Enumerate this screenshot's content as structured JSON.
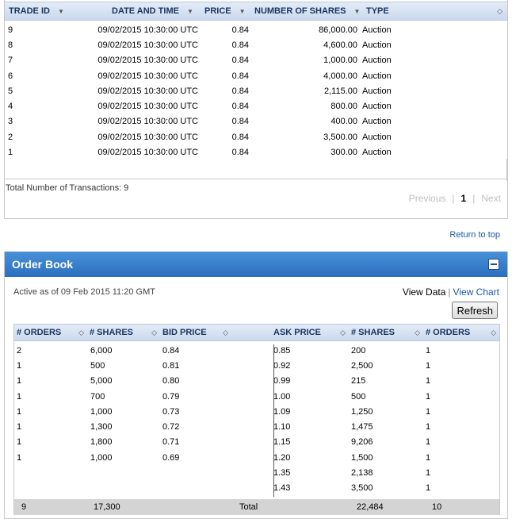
{
  "trades": {
    "headers": {
      "trade_id": "TRADE ID",
      "date_time": "DATE AND TIME",
      "price": "PRICE",
      "num_shares": "NUMBER OF SHARES",
      "type": "TYPE"
    },
    "rows": [
      {
        "id": "9",
        "date": "09/02/2015 10:30:00 UTC",
        "price": "0.84",
        "shares": "86,000.00",
        "type": "Auction"
      },
      {
        "id": "8",
        "date": "09/02/2015 10:30:00 UTC",
        "price": "0.84",
        "shares": "4,600.00",
        "type": "Auction"
      },
      {
        "id": "7",
        "date": "09/02/2015 10:30:00 UTC",
        "price": "0.84",
        "shares": "1,000.00",
        "type": "Auction"
      },
      {
        "id": "6",
        "date": "09/02/2015 10:30:00 UTC",
        "price": "0.84",
        "shares": "4,000.00",
        "type": "Auction"
      },
      {
        "id": "5",
        "date": "09/02/2015 10:30:00 UTC",
        "price": "0.84",
        "shares": "2,115.00",
        "type": "Auction"
      },
      {
        "id": "4",
        "date": "09/02/2015 10:30:00 UTC",
        "price": "0.84",
        "shares": "800.00",
        "type": "Auction"
      },
      {
        "id": "3",
        "date": "09/02/2015 10:30:00 UTC",
        "price": "0.84",
        "shares": "400.00",
        "type": "Auction"
      },
      {
        "id": "2",
        "date": "09/02/2015 10:30:00 UTC",
        "price": "0.84",
        "shares": "3,500.00",
        "type": "Auction"
      },
      {
        "id": "1",
        "date": "09/02/2015 10:30:00 UTC",
        "price": "0.84",
        "shares": "300.00",
        "type": "Auction"
      }
    ],
    "total_label": "Total Number of Transactions: 9",
    "pager": {
      "previous": "Previous",
      "current": "1",
      "next": "Next"
    }
  },
  "return_to_top": "Return to top",
  "order_book": {
    "title": "Order Book",
    "active_as": "Active as of 09 Feb 2015 11:20 GMT",
    "view_data": "View Data",
    "view_chart": "View Chart",
    "refresh": "Refresh",
    "headers": {
      "bid_orders": "# ORDERS",
      "bid_shares": "# SHARES",
      "bid_price": "BID PRICE",
      "ask_price": "ASK PRICE",
      "ask_shares": "# SHARES",
      "ask_orders": "# ORDERS"
    },
    "rows": [
      {
        "bo": "2",
        "bs": "6,000",
        "bp": "0.84",
        "ap": "0.85",
        "as": "200",
        "ao": "1"
      },
      {
        "bo": "1",
        "bs": "500",
        "bp": "0.81",
        "ap": "0.92",
        "as": "2,500",
        "ao": "1"
      },
      {
        "bo": "1",
        "bs": "5,000",
        "bp": "0.80",
        "ap": "0.99",
        "as": "215",
        "ao": "1"
      },
      {
        "bo": "1",
        "bs": "700",
        "bp": "0.79",
        "ap": "1.00",
        "as": "500",
        "ao": "1"
      },
      {
        "bo": "1",
        "bs": "1,000",
        "bp": "0.73",
        "ap": "1.09",
        "as": "1,250",
        "ao": "1"
      },
      {
        "bo": "1",
        "bs": "1,300",
        "bp": "0.72",
        "ap": "1.10",
        "as": "1,475",
        "ao": "1"
      },
      {
        "bo": "1",
        "bs": "1,800",
        "bp": "0.71",
        "ap": "1.15",
        "as": "9,206",
        "ao": "1"
      },
      {
        "bo": "1",
        "bs": "1,000",
        "bp": "0.69",
        "ap": "1.20",
        "as": "1,500",
        "ao": "1"
      },
      {
        "bo": "",
        "bs": "",
        "bp": "",
        "ap": "1.35",
        "as": "2,138",
        "ao": "1"
      },
      {
        "bo": "",
        "bs": "",
        "bp": "",
        "ap": "1.43",
        "as": "3,500",
        "ao": "1"
      }
    ],
    "totals": {
      "bid_orders": "9",
      "bid_shares": "17,300",
      "label": "Total",
      "ask_shares": "22,484",
      "ask_orders": "10"
    }
  }
}
